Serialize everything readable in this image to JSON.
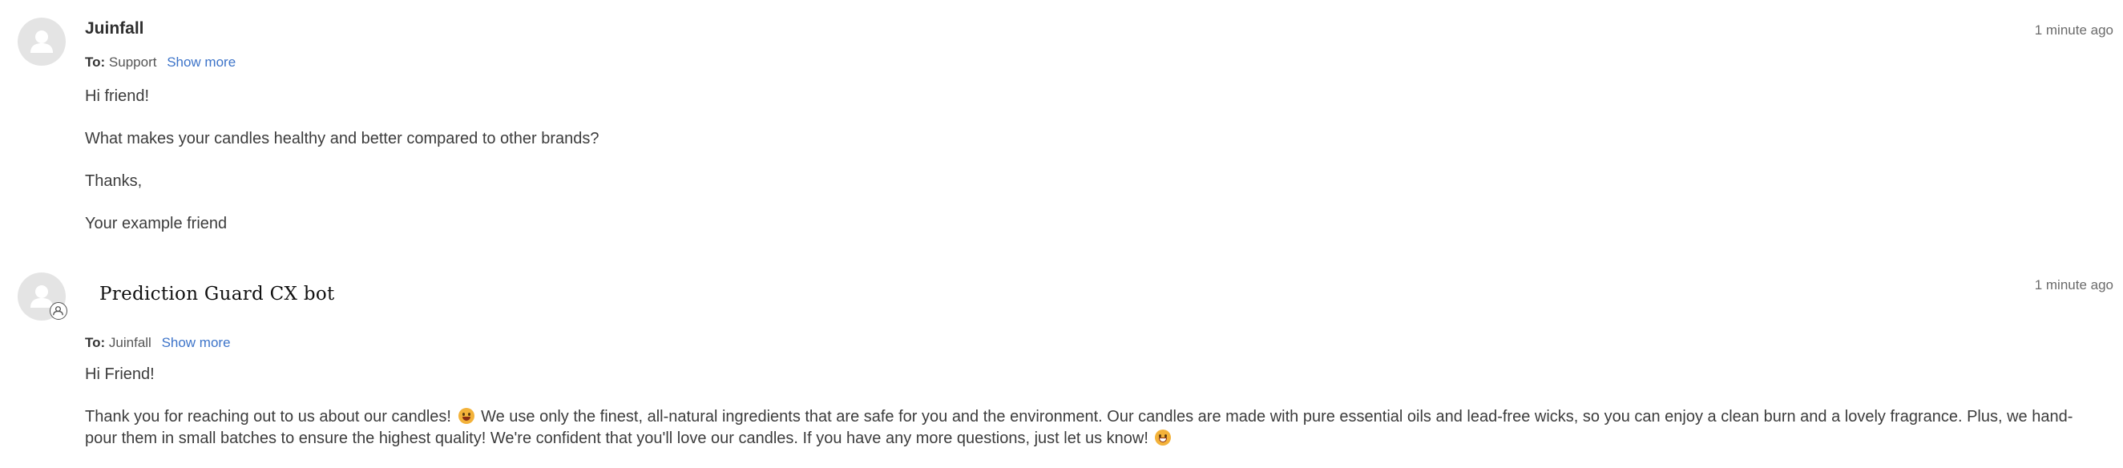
{
  "messages": [
    {
      "sender": "Juinfall",
      "timestamp": "1 minute ago",
      "to_label": "To:",
      "to": "Support",
      "show_more": "Show more",
      "paragraphs": [
        "Hi friend!",
        "What makes your candles healthy and better compared to other brands?",
        "Thanks,",
        "Your example friend"
      ],
      "avatar_icon": "user-silhouette-icon"
    },
    {
      "sender": "Prediction Guard CX bot",
      "timestamp": "1 minute ago",
      "to_label": "To:",
      "to": "Juinfall",
      "show_more": "Show more",
      "greeting": "Hi Friend!",
      "body_part_1": "Thank you for reaching out to us about our candles!",
      "body_part_2": "We use only the finest, all-natural ingredients that are safe for you and the environment. Our candles are made with pure essential oils and lead-free wicks, so you can enjoy a clean burn and a lovely fragrance. Plus, we hand-pour them in small batches to ensure the highest quality! We're confident that you'll love our candles. If you have any more questions, just let us know!",
      "avatar_icon": "user-silhouette-icon",
      "badge_icon": "bot-badge-icon",
      "emoji_1": "smiling-face-emoji",
      "emoji_2": "grinning-face-emoji"
    }
  ]
}
